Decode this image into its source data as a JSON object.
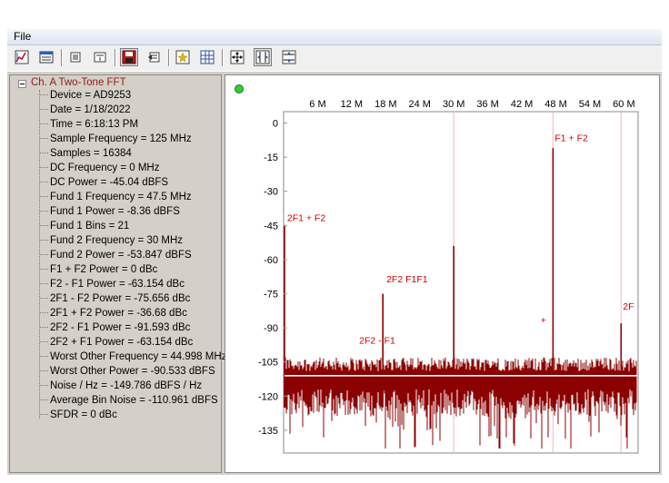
{
  "menu": {
    "file": "File"
  },
  "toolbar": {
    "icons": [
      "chart-icon",
      "grid-icon",
      "list-icon",
      "collapse-icon",
      "save-icon",
      "refresh-icon",
      "star-icon",
      "table-icon",
      "move-icon",
      "fit-horizontal-icon",
      "fit-vertical-icon"
    ]
  },
  "tree": {
    "root": "Ch. A Two-Tone FFT",
    "items": [
      "Device = AD9253",
      "Date = 1/18/2022",
      "Time = 6:18:13 PM",
      "Sample Frequency = 125 MHz",
      "Samples = 16384",
      "DC Frequency = 0 MHz",
      "DC Power = -45.04 dBFS",
      "Fund 1 Frequency = 47.5 MHz",
      "Fund 1 Power = -8.36 dBFS",
      "Fund 1 Bins = 21",
      "Fund 2 Frequency = 30 MHz",
      "Fund 2 Power = -53.847 dBFS",
      "F1 + F2 Power = 0 dBc",
      "F2 - F1 Power = -63.154 dBc",
      "2F1 - F2 Power = -75.656 dBc",
      "2F1 + F2 Power = -36.68 dBc",
      "2F2 - F1 Power = -91.593 dBc",
      "2F2 + F1 Power = -63.154 dBc",
      "Worst Other Frequency = 44.998 MHz",
      "Worst Other Power = -90.533 dBFS",
      "Noise / Hz = -149.786 dBFS / Hz",
      "Average Bin Noise = -110.961 dBFS",
      "SFDR = 0 dBc"
    ]
  },
  "colors": {
    "trace": "#8b0000",
    "label": "#cc0000",
    "status_led": "#33cc33",
    "panel": "#d4d0c8"
  },
  "chart_data": {
    "type": "line",
    "xlim": [
      0,
      62.5
    ],
    "ylim": [
      -145,
      5
    ],
    "x_ticks": [
      6,
      12,
      18,
      24,
      30,
      36,
      42,
      48,
      54,
      60
    ],
    "x_tick_labels": [
      "6 M",
      "12 M",
      "18 M",
      "24 M",
      "30 M",
      "36 M",
      "42 M",
      "48 M",
      "54 M",
      "60 M"
    ],
    "y_ticks": [
      0,
      -15,
      -30,
      -45,
      -60,
      -75,
      -90,
      -105,
      -120,
      -135
    ],
    "y_tick_labels": [
      "0",
      "-15",
      "-30",
      "-45",
      "-60",
      "-75",
      "-90",
      "-105",
      "-120",
      "-135"
    ],
    "noise_floor": -111,
    "spurs": [
      {
        "x": 0.05,
        "y": -45
      },
      {
        "x": 17.5,
        "y": -75
      },
      {
        "x": 30.0,
        "y": -54
      },
      {
        "x": 47.5,
        "y": -11
      },
      {
        "x": 59.5,
        "y": -88
      }
    ],
    "annotations": [
      {
        "text": "F1 + F2",
        "x": 47.5,
        "y": -8
      },
      {
        "text": "2F1 + F2",
        "x": 0.3,
        "y": -43
      },
      {
        "text": "2F2 F1F1",
        "x": 17.8,
        "y": -70
      },
      {
        "text": "2F2 - F1",
        "x": 13.0,
        "y": -97
      },
      {
        "text": "2F",
        "x": 59.5,
        "y": -82
      },
      {
        "text": "+",
        "x": 45.0,
        "y": -88
      }
    ],
    "guide_lines_x": [
      30.0,
      47.5,
      59.5
    ]
  }
}
